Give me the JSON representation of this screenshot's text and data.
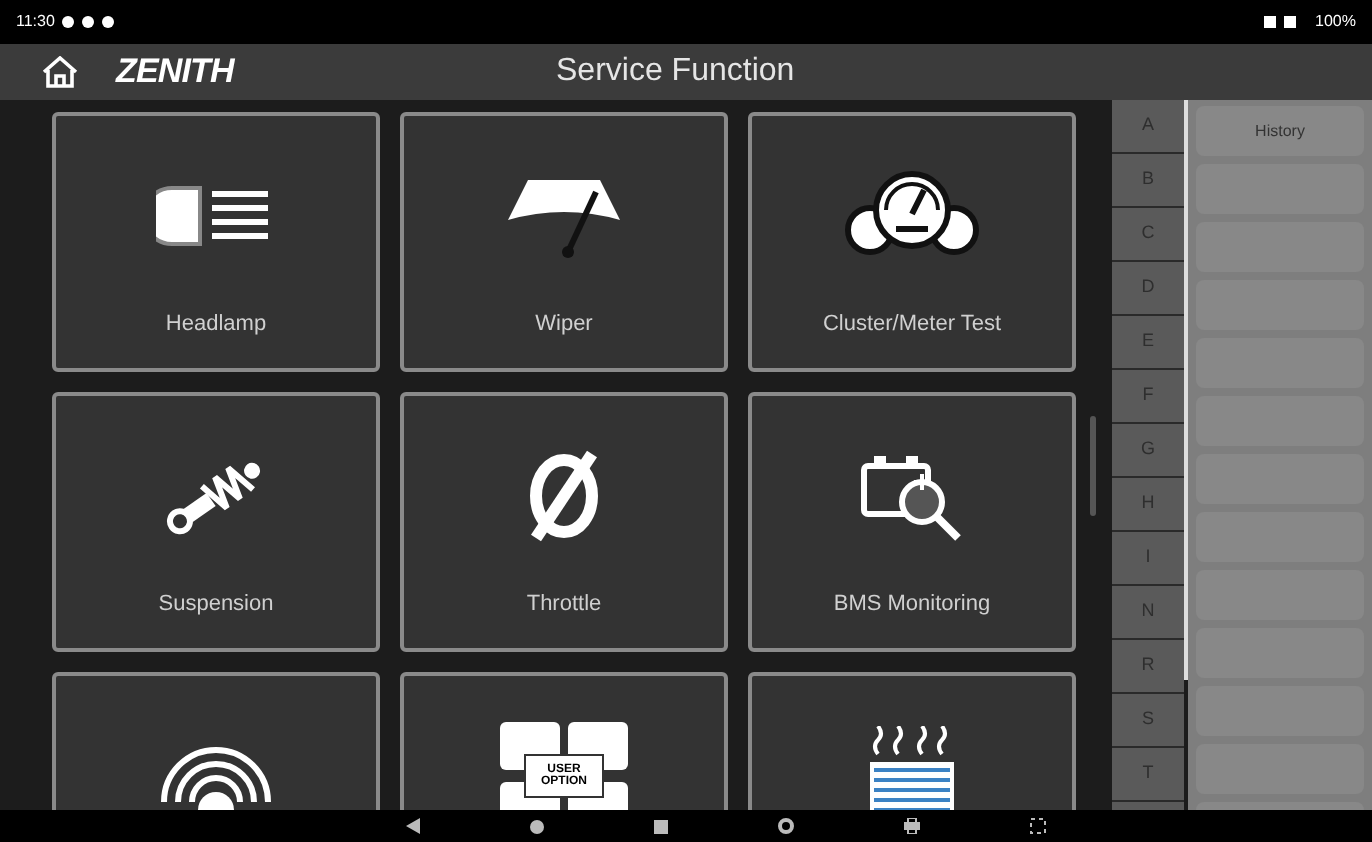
{
  "status_bar": {
    "time": "11:30",
    "battery": "100%"
  },
  "header": {
    "logo": "ZENITH",
    "title": "Service Function"
  },
  "tiles": [
    {
      "kind": "headlamp",
      "label": "Headlamp"
    },
    {
      "kind": "wiper",
      "label": "Wiper"
    },
    {
      "kind": "cluster",
      "label": "Cluster/Meter Test"
    },
    {
      "kind": "suspension",
      "label": "Suspension"
    },
    {
      "kind": "throttle",
      "label": "Throttle"
    },
    {
      "kind": "bms",
      "label": "BMS Monitoring"
    },
    {
      "kind": "signal"
    },
    {
      "kind": "option",
      "icon_text": [
        "USER",
        "OPTION"
      ]
    },
    {
      "kind": "heater"
    }
  ],
  "index_letters": [
    "A",
    "B",
    "C",
    "D",
    "E",
    "F",
    "G",
    "H",
    "I",
    "N",
    "R",
    "S",
    "T"
  ],
  "history": {
    "title": "History"
  }
}
